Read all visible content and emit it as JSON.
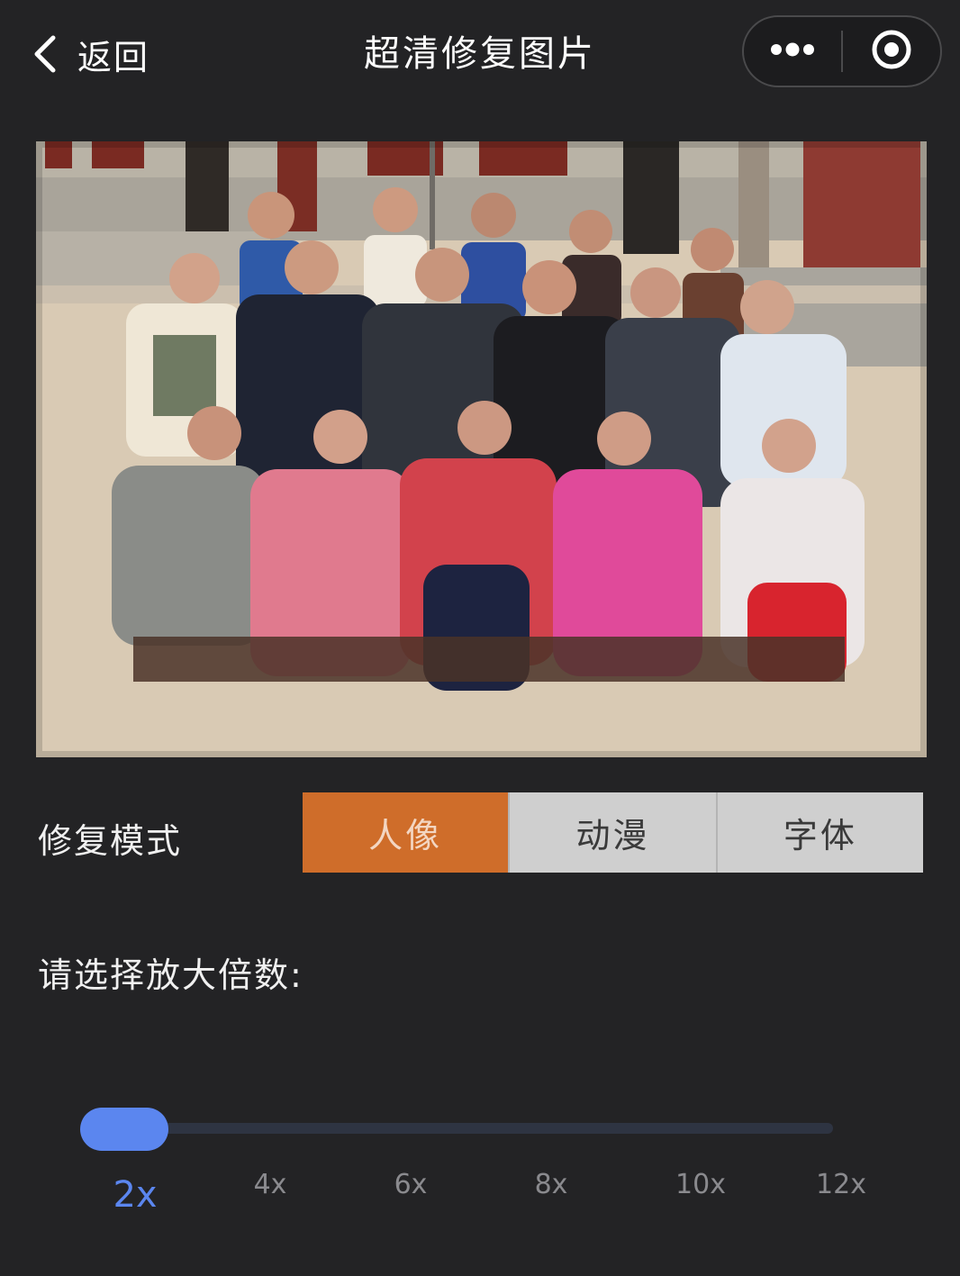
{
  "navbar": {
    "back_label": "返回",
    "title": "超清修复图片",
    "capsule": {
      "more_icon": "more-dots-icon",
      "close_icon": "record-circle-icon"
    }
  },
  "photo": {
    "subject": "school class group photo"
  },
  "mode": {
    "label": "修复模式",
    "options": [
      "人像",
      "动漫",
      "字体"
    ],
    "selected": "人像"
  },
  "scale": {
    "label": "请选择放大倍数:",
    "options": [
      "2x",
      "4x",
      "6x",
      "8x",
      "10x",
      "12x"
    ],
    "selected": "2x"
  },
  "colors": {
    "background": "#232325",
    "accent_orange": "#cf6d2a",
    "accent_blue": "#5b86ef",
    "segment_gray": "#cfcfcf"
  }
}
